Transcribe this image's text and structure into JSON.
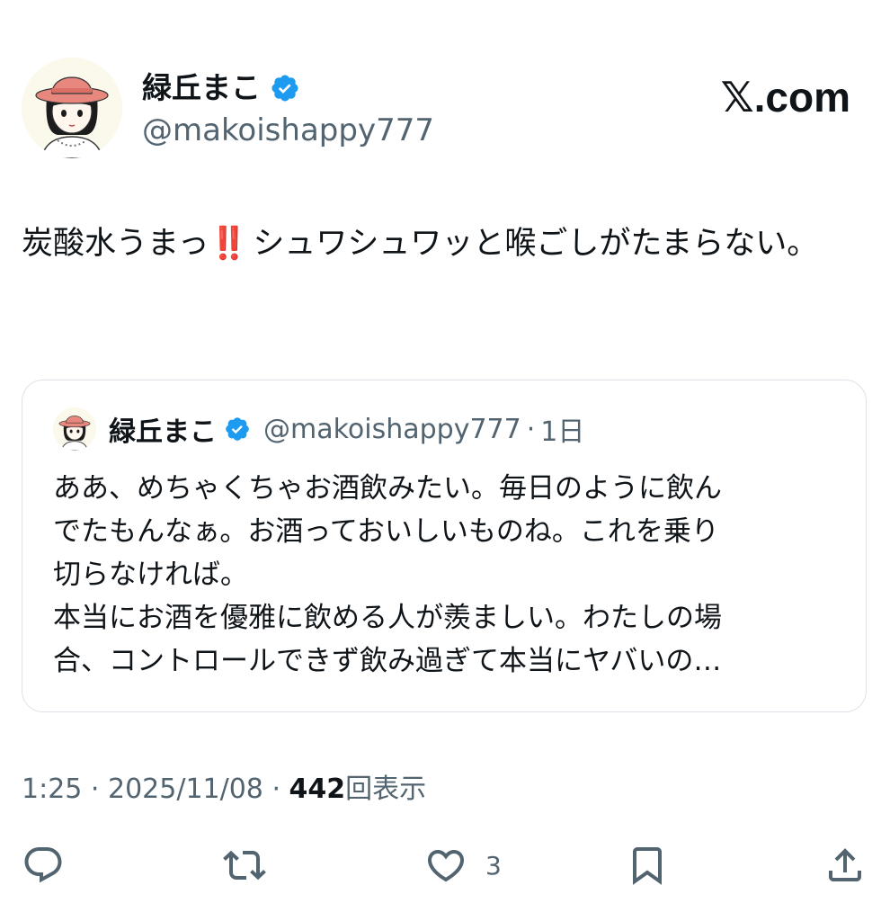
{
  "header": {
    "display_name": "緑丘まこ",
    "handle": "@makoishappy777",
    "brand": "𝕏.com"
  },
  "tweet": {
    "text_before": "炭酸水うまっ",
    "emoji": "‼️",
    "text_after": " シュワシュワッと喉ごしがたまらない。"
  },
  "quote": {
    "display_name": "緑丘まこ",
    "handle": "@makoishappy777",
    "separator": "·",
    "time": "1日",
    "lines": [
      "ああ、めちゃくちゃお酒飲みたい。毎日のように飲ん",
      "でたもんなぁ。お酒っておいしいものね。これを乗り",
      "切らなければ。",
      "本当にお酒を優雅に飲める人が羨ましい。わたしの場",
      "合、コントロールできず飲み過ぎて本当にヤバいの…"
    ]
  },
  "meta": {
    "time": "1:25",
    "sep1": " · ",
    "date": "2025/11/08",
    "sep2": " · ",
    "views_count": "442",
    "views_label": "回表示"
  },
  "actions": {
    "reply_icon": "reply-icon",
    "retweet_icon": "retweet-icon",
    "like_icon": "heart-icon",
    "like_count": "3",
    "bookmark_icon": "bookmark-icon",
    "share_icon": "share-icon"
  },
  "colors": {
    "text": "#0f1419",
    "secondary": "#536471",
    "verified": "#1d9bf0",
    "border": "#dde3e8",
    "hat": "#e8877e"
  }
}
